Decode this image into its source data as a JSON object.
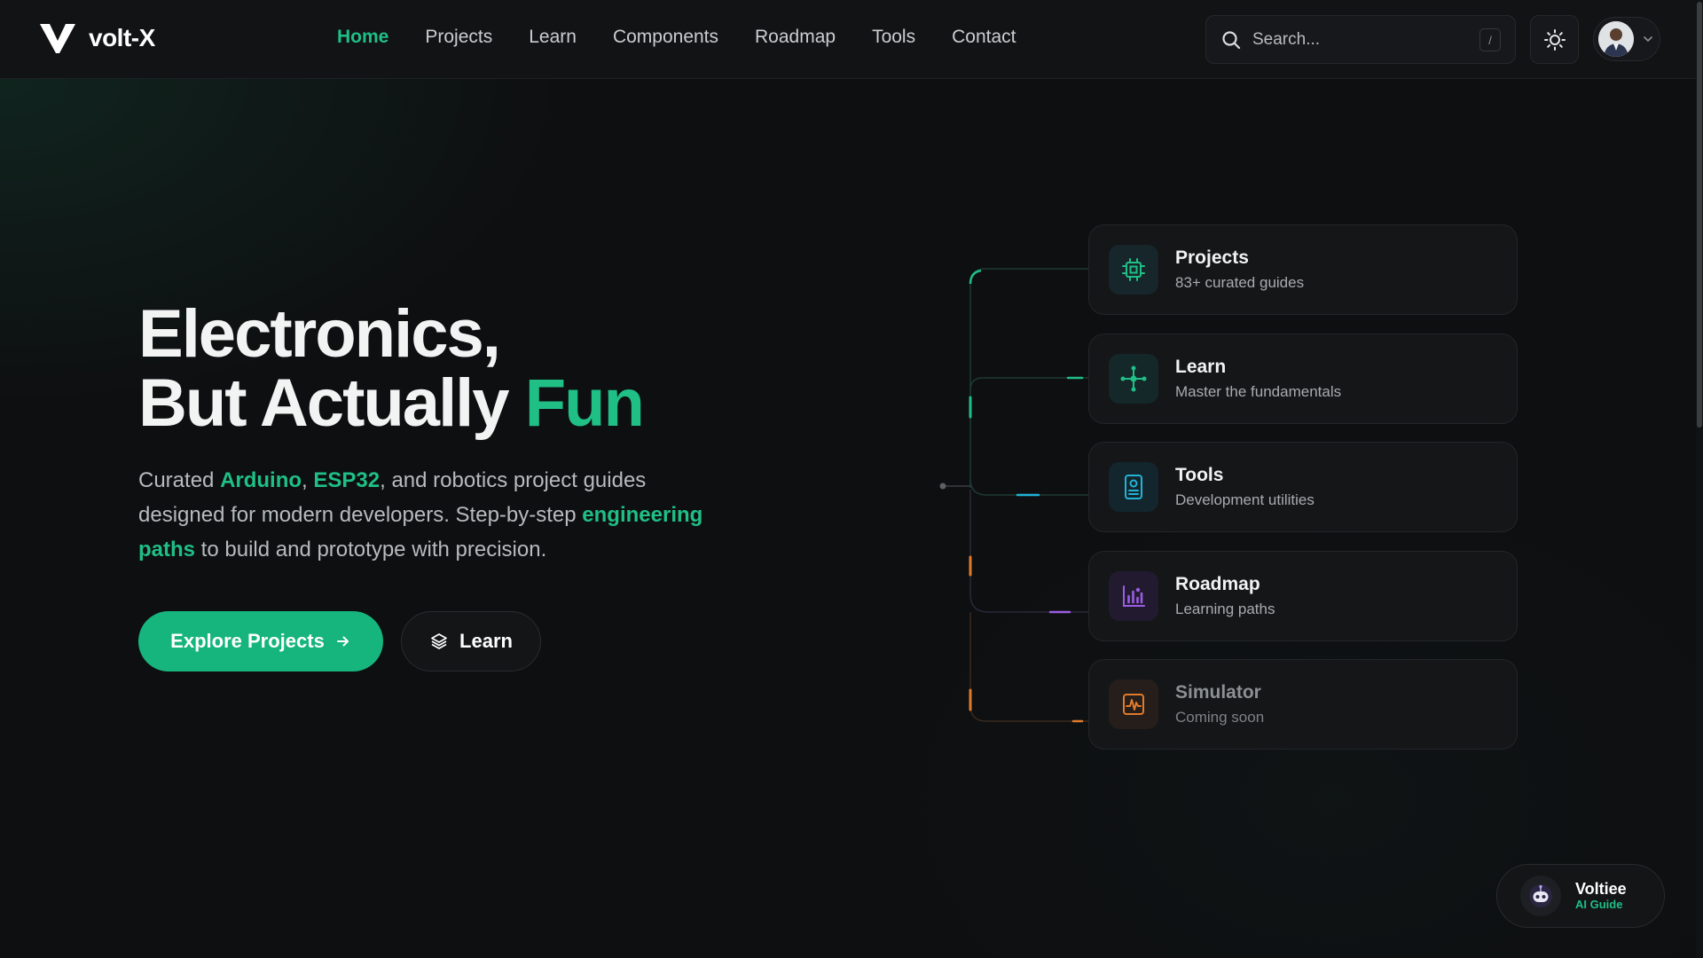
{
  "brand": {
    "name": "volt-X"
  },
  "nav": {
    "links": [
      {
        "label": "Home",
        "active": true
      },
      {
        "label": "Projects",
        "active": false
      },
      {
        "label": "Learn",
        "active": false
      },
      {
        "label": "Components",
        "active": false
      },
      {
        "label": "Roadmap",
        "active": false
      },
      {
        "label": "Tools",
        "active": false
      },
      {
        "label": "Contact",
        "active": false
      }
    ],
    "search": {
      "placeholder": "Search...",
      "shortcut": "/"
    },
    "theme_icon": "sun-icon",
    "user_icon": "avatar"
  },
  "hero": {
    "title_line1": "Electronics,",
    "title_line2_prefix": "But Actually ",
    "title_line2_accent": "Fun",
    "desc_1": "Curated ",
    "desc_arduino": "Arduino",
    "desc_2": ", ",
    "desc_esp32": "ESP32",
    "desc_3": ", and robotics project guides designed for modern developers. Step-by-step ",
    "desc_eng": "engineering paths",
    "desc_4": " to build and prototype with precision.",
    "primary_cta": "Explore Projects",
    "secondary_cta": "Learn"
  },
  "cards": [
    {
      "title": "Projects",
      "subtitle": "83+ curated guides",
      "icon": "chip-icon",
      "color": "#1fbf86"
    },
    {
      "title": "Learn",
      "subtitle": "Master the fundamentals",
      "icon": "network-icon",
      "color": "#1fbf86"
    },
    {
      "title": "Tools",
      "subtitle": "Development utilities",
      "icon": "device-icon",
      "color": "#22b3d6"
    },
    {
      "title": "Roadmap",
      "subtitle": "Learning paths",
      "icon": "bar-chart-icon",
      "color": "#9b5de5"
    },
    {
      "title": "Simulator",
      "subtitle": "Coming soon",
      "icon": "waveform-icon",
      "color": "#e07b2c"
    }
  ],
  "assistant": {
    "name": "Voltiee",
    "role": "AI Guide"
  },
  "colors": {
    "accent": "#1fbf86",
    "background": "#0e0f11"
  }
}
